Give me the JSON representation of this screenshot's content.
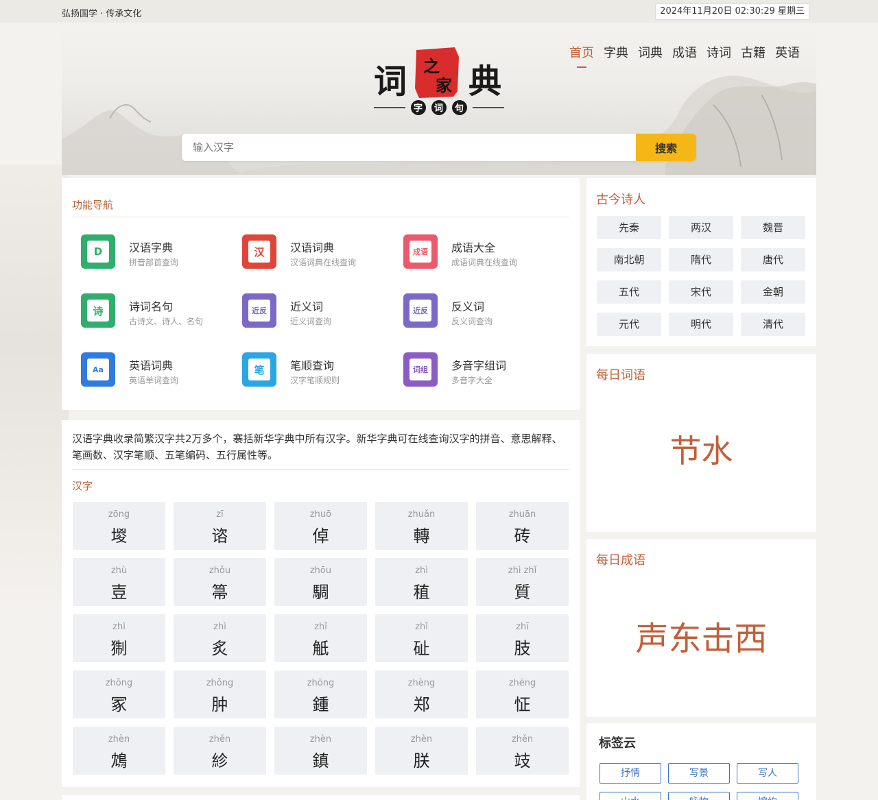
{
  "topbar": {
    "slogan": "弘扬国学 · 传承文化",
    "clock": "2024年11月20日 02:30:29 星期三"
  },
  "logo": {
    "left_char": "词",
    "seal_top": "之",
    "seal_bottom": "家",
    "right_char": "典",
    "sub_chars": [
      "字",
      "词",
      "句"
    ]
  },
  "nav": [
    "首页",
    "字典",
    "词典",
    "成语",
    "诗词",
    "古籍",
    "英语"
  ],
  "search": {
    "placeholder": "输入汉字",
    "button": "搜索"
  },
  "colors": {
    "accent": "#c0603a",
    "search_button": "#f5b716",
    "tag_blue": "#3a74c4"
  },
  "functions": {
    "title": "功能导航",
    "items": [
      {
        "name": "汉语字典",
        "desc": "拼音部首查询",
        "icon": "D",
        "color": "#2fae6d"
      },
      {
        "name": "汉语词典",
        "desc": "汉语词典在线查询",
        "icon": "汉",
        "color": "#e0453a"
      },
      {
        "name": "成语大全",
        "desc": "成语词典在线查询",
        "icon": "成语",
        "color": "#ea5a6a"
      },
      {
        "name": "诗词名句",
        "desc": "古诗文、诗人、名句",
        "icon": "诗",
        "color": "#2fae6d"
      },
      {
        "name": "近义词",
        "desc": "近义词查询",
        "icon": "近反",
        "color": "#7b68c9"
      },
      {
        "name": "反义词",
        "desc": "反义词查询",
        "icon": "近反",
        "color": "#7b68c9"
      },
      {
        "name": "英语词典",
        "desc": "英语单词查询",
        "icon": "Aa",
        "color": "#2f7be0"
      },
      {
        "name": "笔顺查询",
        "desc": "汉字笔顺规则",
        "icon": "笔",
        "color": "#2aa6e6"
      },
      {
        "name": "多音字组词",
        "desc": "多音字大全",
        "icon": "词组",
        "color": "#8a5cc4"
      }
    ]
  },
  "hanzi": {
    "intro": "汉语字典收录简繁汉字共2万多个，褰括新华字典中所有汉字。新华字典可在线查询汉字的拼音、意思解释、笔画数、汉字笔顺、五笔编码、五行属性等。",
    "title": "汉字",
    "chars": [
      {
        "py": "zōng",
        "ch": "堫"
      },
      {
        "py": "zī",
        "ch": "谘"
      },
      {
        "py": "zhuō",
        "ch": "倬"
      },
      {
        "py": "zhuǎn",
        "ch": "轉"
      },
      {
        "py": "zhuān",
        "ch": "砖"
      },
      {
        "py": "zhù",
        "ch": "壴"
      },
      {
        "py": "zhǒu",
        "ch": "箒"
      },
      {
        "py": "zhōu",
        "ch": "騆"
      },
      {
        "py": "zhì",
        "ch": "稙"
      },
      {
        "py": "zhì zhǐ",
        "ch": "質"
      },
      {
        "py": "zhì",
        "ch": "猘"
      },
      {
        "py": "zhì",
        "ch": "炙"
      },
      {
        "py": "zhǐ",
        "ch": "觗"
      },
      {
        "py": "zhǐ",
        "ch": "砋"
      },
      {
        "py": "zhī",
        "ch": "肢"
      },
      {
        "py": "zhǒng",
        "ch": "冢"
      },
      {
        "py": "zhǒng",
        "ch": "肿"
      },
      {
        "py": "zhōng",
        "ch": "鍾"
      },
      {
        "py": "zhèng",
        "ch": "郑"
      },
      {
        "py": "zhēng",
        "ch": "怔"
      },
      {
        "py": "zhèn",
        "ch": "鴆"
      },
      {
        "py": "zhěn",
        "ch": "紾"
      },
      {
        "py": "zhèn",
        "ch": "鎮"
      },
      {
        "py": "zhèn",
        "ch": "朕"
      },
      {
        "py": "zhěn",
        "ch": "攱"
      }
    ]
  },
  "poets": {
    "title": "古今诗人",
    "eras": [
      "先秦",
      "两汉",
      "魏晋",
      "南北朝",
      "隋代",
      "唐代",
      "五代",
      "宋代",
      "金朝",
      "元代",
      "明代",
      "清代"
    ]
  },
  "daily_word": {
    "title": "每日词语",
    "word": "节水"
  },
  "daily_idiom": {
    "title": "每日成语",
    "word": "声东击西"
  },
  "tags": {
    "title": "标签云",
    "items": [
      "抒情",
      "写景",
      "写人",
      "山水",
      "咏物",
      "婉约"
    ]
  }
}
